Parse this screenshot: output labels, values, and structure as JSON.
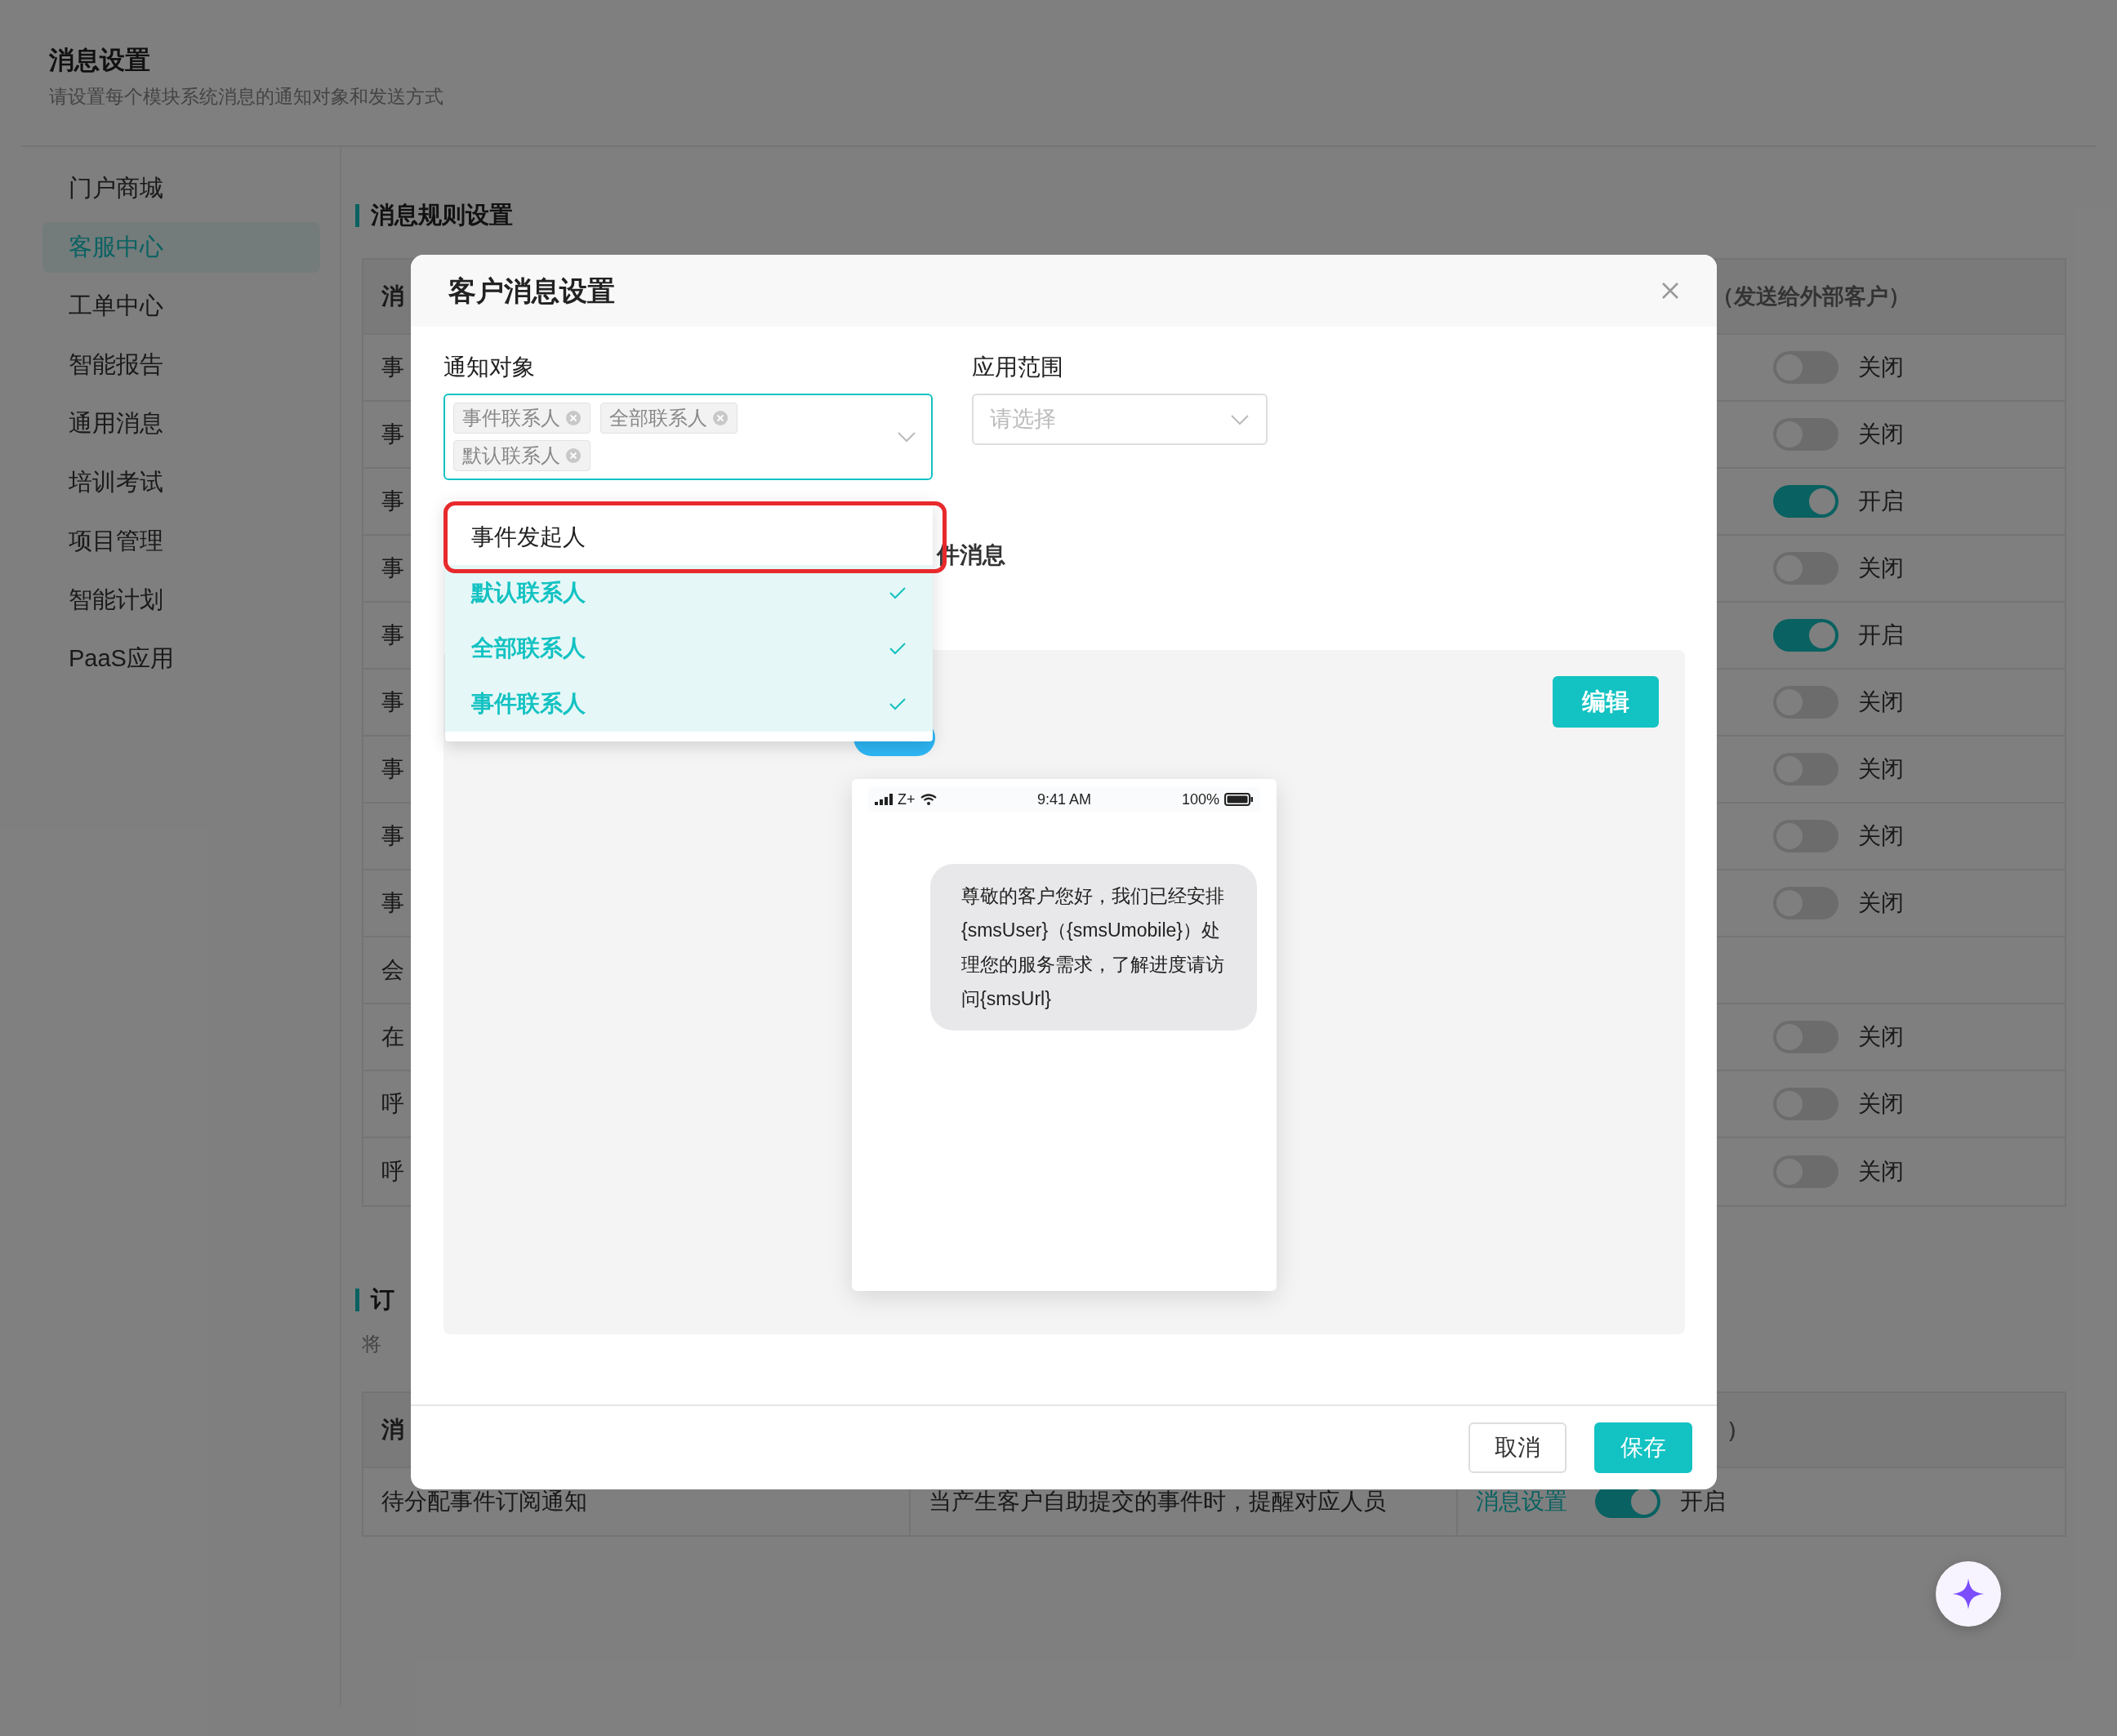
{
  "page": {
    "title": "消息设置",
    "subtitle": "请设置每个模块系统消息的通知对象和发送方式"
  },
  "sidebar": {
    "items": [
      {
        "label": "门户商城",
        "selected": false
      },
      {
        "label": "客服中心",
        "selected": true
      },
      {
        "label": "工单中心",
        "selected": false
      },
      {
        "label": "智能报告",
        "selected": false
      },
      {
        "label": "通用消息",
        "selected": false
      },
      {
        "label": "培训考试",
        "selected": false
      },
      {
        "label": "项目管理",
        "selected": false
      },
      {
        "label": "智能计划",
        "selected": false
      },
      {
        "label": "PaaS应用",
        "selected": false
      }
    ]
  },
  "rules_section": {
    "title": "消息规则设置",
    "table": {
      "header_left": "消",
      "header_right": "（发送给外部客户）",
      "rows": [
        {
          "kind": "toggle",
          "cell": "事",
          "on": false,
          "state_label": "关闭"
        },
        {
          "kind": "toggle",
          "cell": "事",
          "on": false,
          "state_label": "关闭"
        },
        {
          "kind": "toggle",
          "cell": "事",
          "on": true,
          "state_label": "开启"
        },
        {
          "kind": "toggle",
          "cell": "事",
          "on": false,
          "state_label": "关闭"
        },
        {
          "kind": "toggle",
          "cell": "事",
          "on": true,
          "state_label": "开启"
        },
        {
          "kind": "toggle",
          "cell": "事",
          "on": false,
          "state_label": "关闭"
        },
        {
          "kind": "toggle",
          "cell": "事",
          "on": false,
          "state_label": "关闭"
        },
        {
          "kind": "toggle",
          "cell": "事",
          "on": false,
          "state_label": "关闭"
        },
        {
          "kind": "toggle",
          "cell": "事",
          "on": false,
          "state_label": "关闭"
        },
        {
          "kind": "plain",
          "cell": "会"
        },
        {
          "kind": "toggle",
          "cell": "在",
          "on": false,
          "state_label": "关闭"
        },
        {
          "kind": "toggle",
          "cell": "呼",
          "on": false,
          "state_label": "关闭"
        },
        {
          "kind": "toggle",
          "cell": "呼",
          "on": false,
          "state_label": "关闭"
        }
      ]
    }
  },
  "subscription_section": {
    "title": "订",
    "description": "将",
    "table": {
      "header_left": "消",
      "header_right": "）",
      "rows": [
        {
          "name": "待分配事件订阅通知",
          "description": "当产生客户自助提交的事件时，提醒对应人员",
          "link": "消息设置",
          "on": true,
          "state_label": "开启"
        }
      ]
    }
  },
  "modal": {
    "title": "客户消息设置",
    "fields": [
      {
        "kind": "tags",
        "label": "通知对象",
        "focused": true,
        "tags": [
          "事件联系人",
          "全部联系人",
          "默认联系人"
        ]
      },
      {
        "kind": "select",
        "label": "应用范围",
        "placeholder": "请选择"
      }
    ],
    "dropdown": {
      "options": [
        {
          "label": "事件发起人",
          "selected": false,
          "outlined": true
        },
        {
          "label": "默认联系人",
          "selected": true,
          "outlined": false
        },
        {
          "label": "全部联系人",
          "selected": true,
          "outlined": false
        },
        {
          "label": "事件联系人",
          "selected": true,
          "outlined": false
        }
      ]
    },
    "section_heading": "件消息",
    "preview": {
      "edit_button": "编辑",
      "carrier": "Z+",
      "time": "9:41 AM",
      "battery": "100%",
      "message": "尊敬的客户您好，我们已经安排{smsUser}（{smsUmobile}）处理您的服务需求，了解进度请访问{smsUrl}"
    },
    "buttons": [
      {
        "kind": "secondary",
        "label": "取消"
      },
      {
        "kind": "primary",
        "label": "保存"
      }
    ]
  }
}
